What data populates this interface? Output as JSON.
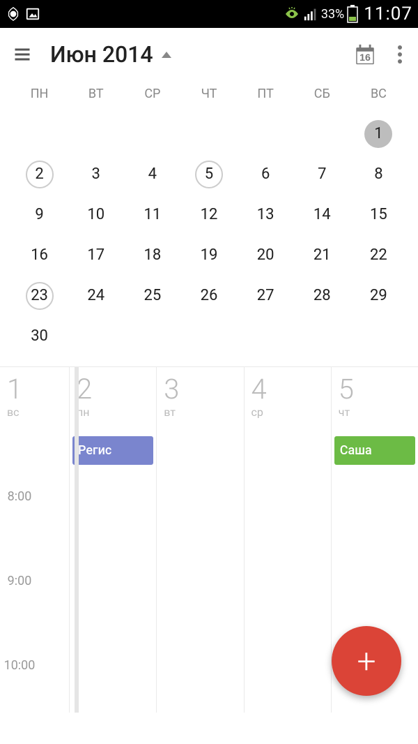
{
  "status": {
    "battery_pct": "33%",
    "clock": "11:07"
  },
  "header": {
    "title": "Июн 2014",
    "today_badge": "16"
  },
  "month": {
    "dow": [
      "ПН",
      "ВТ",
      "СР",
      "ЧТ",
      "ПТ",
      "СБ",
      "ВС"
    ],
    "weeks": [
      [
        {
          "n": "",
          "s": ""
        },
        {
          "n": "",
          "s": ""
        },
        {
          "n": "",
          "s": ""
        },
        {
          "n": "",
          "s": ""
        },
        {
          "n": "",
          "s": ""
        },
        {
          "n": "",
          "s": ""
        },
        {
          "n": "1",
          "s": "selected"
        }
      ],
      [
        {
          "n": "2",
          "s": "circled"
        },
        {
          "n": "3",
          "s": ""
        },
        {
          "n": "4",
          "s": ""
        },
        {
          "n": "5",
          "s": "circled"
        },
        {
          "n": "6",
          "s": ""
        },
        {
          "n": "7",
          "s": ""
        },
        {
          "n": "8",
          "s": ""
        }
      ],
      [
        {
          "n": "9",
          "s": ""
        },
        {
          "n": "10",
          "s": ""
        },
        {
          "n": "11",
          "s": ""
        },
        {
          "n": "12",
          "s": ""
        },
        {
          "n": "13",
          "s": ""
        },
        {
          "n": "14",
          "s": ""
        },
        {
          "n": "15",
          "s": ""
        }
      ],
      [
        {
          "n": "16",
          "s": ""
        },
        {
          "n": "17",
          "s": ""
        },
        {
          "n": "18",
          "s": ""
        },
        {
          "n": "19",
          "s": ""
        },
        {
          "n": "20",
          "s": ""
        },
        {
          "n": "21",
          "s": ""
        },
        {
          "n": "22",
          "s": ""
        }
      ],
      [
        {
          "n": "23",
          "s": "circled"
        },
        {
          "n": "24",
          "s": ""
        },
        {
          "n": "25",
          "s": ""
        },
        {
          "n": "26",
          "s": ""
        },
        {
          "n": "27",
          "s": ""
        },
        {
          "n": "28",
          "s": ""
        },
        {
          "n": "29",
          "s": ""
        }
      ],
      [
        {
          "n": "30",
          "s": ""
        },
        {
          "n": "",
          "s": ""
        },
        {
          "n": "",
          "s": ""
        },
        {
          "n": "",
          "s": ""
        },
        {
          "n": "",
          "s": ""
        },
        {
          "n": "",
          "s": ""
        },
        {
          "n": "",
          "s": ""
        }
      ]
    ]
  },
  "schedule": {
    "days": [
      {
        "num": "1",
        "dow": "вс",
        "event": null
      },
      {
        "num": "2",
        "dow": "пн",
        "event": {
          "label": "Регис",
          "color": "blue"
        }
      },
      {
        "num": "3",
        "dow": "вт",
        "event": null
      },
      {
        "num": "4",
        "dow": "ср",
        "event": null
      },
      {
        "num": "5",
        "dow": "чт",
        "event": {
          "label": "Саша",
          "color": "green"
        }
      }
    ],
    "time_labels": [
      "8:00",
      "9:00",
      "10:00"
    ]
  }
}
